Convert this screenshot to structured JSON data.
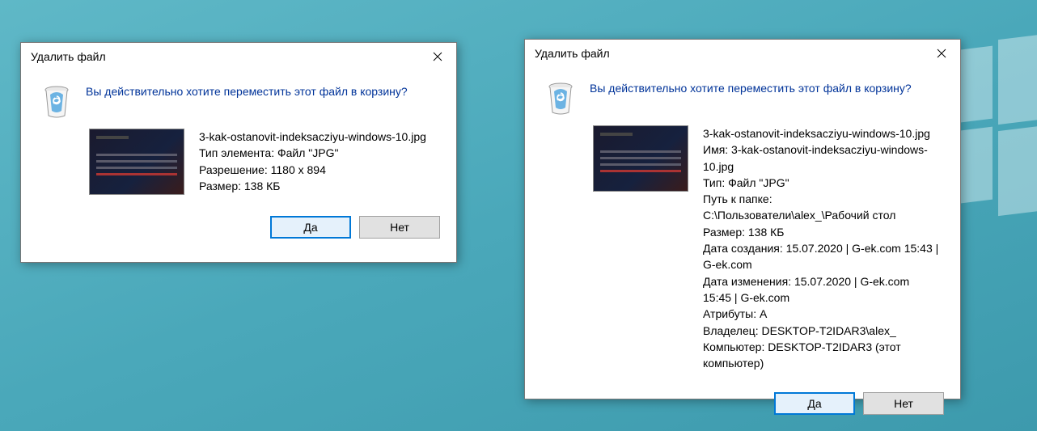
{
  "dialog1": {
    "title": "Удалить файл",
    "heading": "Вы действительно хотите переместить этот файл в корзину?",
    "filename": "3-kak-ostanovit-indeksacziyu-windows-10.jpg",
    "lines": [
      "Тип элемента: Файл \"JPG\"",
      "Разрешение: 1180 x 894",
      "Размер: 138 КБ"
    ],
    "yes_label": "Да",
    "no_label": "Нет"
  },
  "dialog2": {
    "title": "Удалить файл",
    "heading": "Вы действительно хотите переместить этот файл в корзину?",
    "filename": "3-kak-ostanovit-indeksacziyu-windows-10.jpg",
    "lines": [
      "Имя: 3-kak-ostanovit-indeksacziyu-windows-10.jpg",
      "Тип: Файл \"JPG\"",
      "Путь к папке: C:\\Пользователи\\alex_\\Рабочий стол",
      "Размер: 138 КБ",
      "Дата создания: 15.07.2020 | G-ek.com 15:43 | G-ek.com",
      "Дата изменения: 15.07.2020 | G-ek.com 15:45 | G-ek.com",
      "Атрибуты: A",
      "Владелец: DESKTOP-T2IDAR3\\alex_",
      "Компьютер: DESKTOP-T2IDAR3 (этот компьютер)"
    ],
    "yes_label": "Да",
    "no_label": "Нет"
  }
}
